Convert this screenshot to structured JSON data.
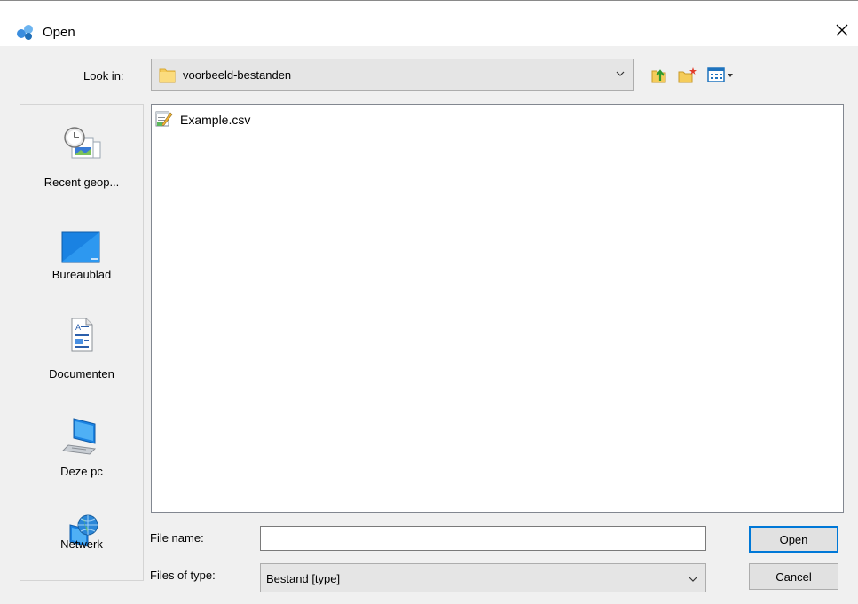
{
  "window": {
    "title": "Open",
    "close_glyph": "✕"
  },
  "lookin": {
    "label": "Look in:",
    "value": "voorbeeld-bestanden"
  },
  "toolbar": {
    "icons": [
      "up-one-level-icon",
      "create-new-folder-icon",
      "view-menu-icon"
    ]
  },
  "places": [
    {
      "label": "Recent geop...",
      "icon": "recent-items-icon"
    },
    {
      "label": "Bureaublad",
      "icon": "desktop-icon"
    },
    {
      "label": "Documenten",
      "icon": "documents-icon"
    },
    {
      "label": "Deze pc",
      "icon": "computer-icon"
    },
    {
      "label": "Netwerk",
      "icon": "network-icon"
    }
  ],
  "files": [
    {
      "name": "Example.csv",
      "icon": "csv-file-icon"
    }
  ],
  "filename": {
    "label": "File name:",
    "value": "",
    "placeholder": ""
  },
  "filetype": {
    "label": "Files of type:",
    "value": "Bestand [type]"
  },
  "buttons": {
    "open": "Open",
    "cancel": "Cancel"
  },
  "colors": {
    "accent": "#0078d7",
    "folder": "#f5cc5a",
    "dialog_bg": "#f0f0f0"
  }
}
